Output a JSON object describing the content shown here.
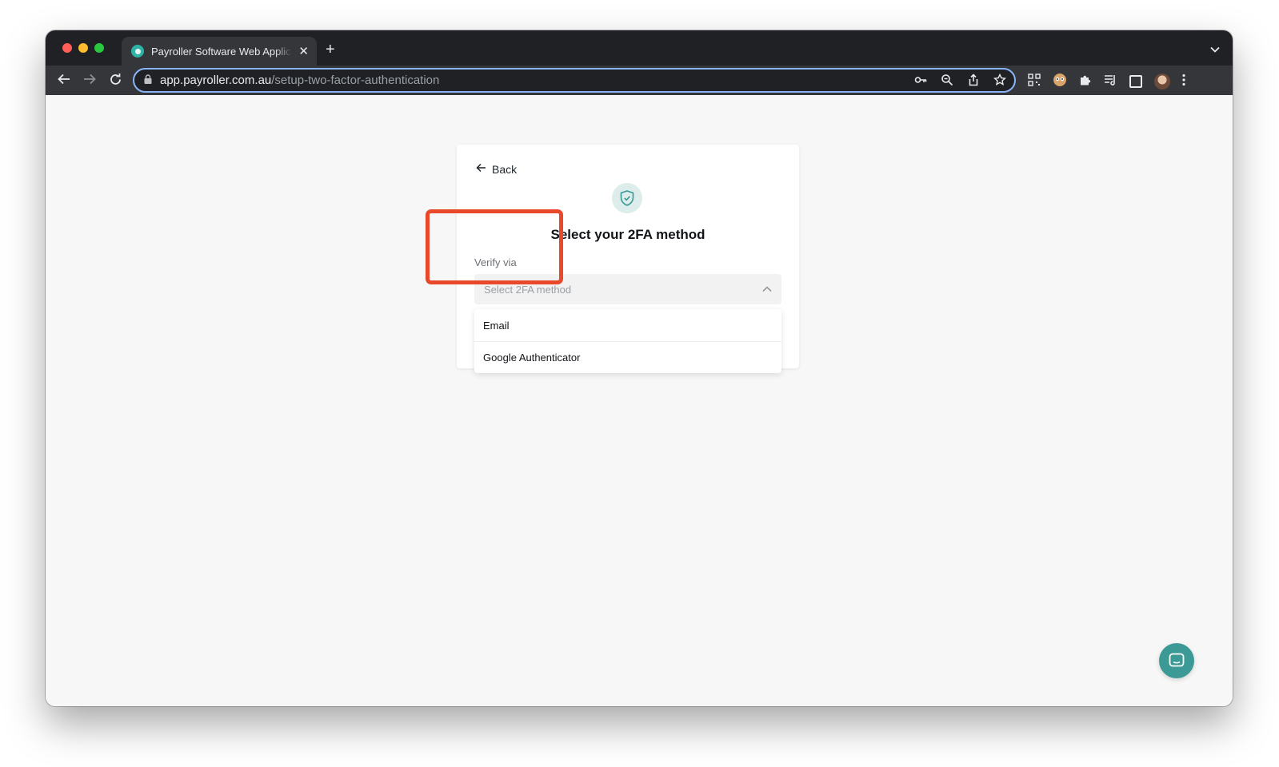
{
  "browser": {
    "tab": {
      "title": "Payroller Software Web Application",
      "close_glyph": "✕"
    },
    "new_tab_glyph": "+",
    "tab_menu_glyph": "⌄",
    "address_bar": {
      "host": "app.payroller.com.au",
      "path": "/setup-two-factor-authentication"
    }
  },
  "page": {
    "back_label": "Back",
    "title": "Select your 2FA method",
    "field_label": "Verify via",
    "select": {
      "placeholder": "Select 2FA method",
      "expanded": true,
      "options": [
        "Email",
        "Google Authenticator"
      ]
    }
  },
  "colors": {
    "brand_teal": "#3c9a96",
    "highlight_red": "#e8492a",
    "address_focus": "#8ab4f8"
  },
  "icons": {
    "badge": "shield-check-icon",
    "chat": "chat-icon"
  }
}
